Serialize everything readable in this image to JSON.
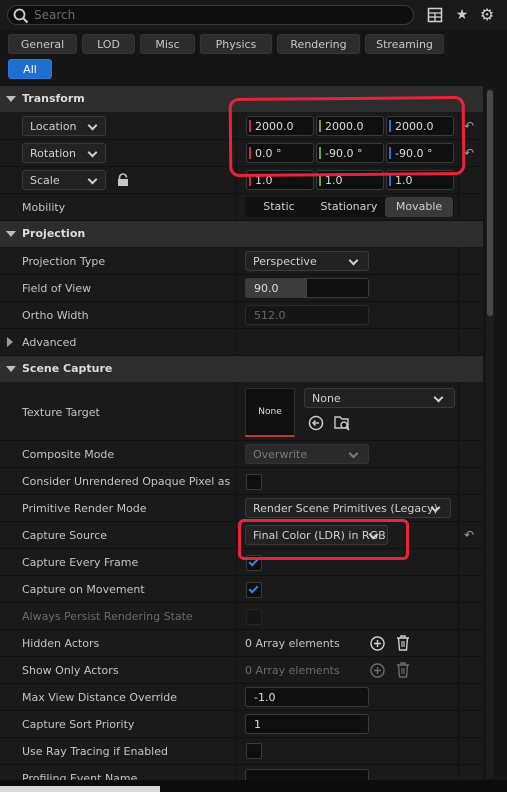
{
  "search": {
    "placeholder": "Search"
  },
  "toolbar": {
    "icons": [
      "table-icon",
      "star-icon",
      "gear-icon"
    ]
  },
  "filters": {
    "tabs": [
      "General",
      "LOD",
      "Misc",
      "Physics",
      "Rendering",
      "Streaming"
    ],
    "all": "All"
  },
  "transform": {
    "title": "Transform",
    "location": {
      "label": "Location",
      "x": "2000.0",
      "y": "2000.0",
      "z": "2000.0"
    },
    "rotation": {
      "label": "Rotation",
      "x": "0.0 °",
      "y": "-90.0 °",
      "z": "-90.0 °"
    },
    "scale": {
      "label": "Scale",
      "x": "1.0",
      "y": "1.0",
      "z": "1.0"
    },
    "mobility": {
      "label": "Mobility",
      "options": [
        "Static",
        "Stationary",
        "Movable"
      ],
      "selected": "Movable"
    }
  },
  "projection": {
    "title": "Projection",
    "projection_type": {
      "label": "Projection Type",
      "value": "Perspective"
    },
    "fov": {
      "label": "Field of View",
      "value": "90.0",
      "fill_fraction": 0.5
    },
    "ortho_width": {
      "label": "Ortho Width",
      "value": "512.0"
    },
    "advanced": "Advanced"
  },
  "scene_capture": {
    "title": "Scene Capture",
    "texture_target": {
      "label": "Texture Target",
      "thumb": "None",
      "value": "None"
    },
    "composite_mode": {
      "label": "Composite Mode",
      "value": "Overwrite"
    },
    "consider_unrendered": {
      "label": "Consider Unrendered Opaque Pixel as F...",
      "checked": false
    },
    "primitive_render_mode": {
      "label": "Primitive Render Mode",
      "value": "Render Scene Primitives (Legacy)"
    },
    "capture_source": {
      "label": "Capture Source",
      "value": "Final Color (LDR) in RGB"
    },
    "capture_every_frame": {
      "label": "Capture Every Frame",
      "checked": true
    },
    "capture_on_movement": {
      "label": "Capture on Movement",
      "checked": true
    },
    "always_persist": {
      "label": "Always Persist Rendering State",
      "checked": false
    },
    "hidden_actors": {
      "label": "Hidden Actors",
      "value": "0 Array elements"
    },
    "show_only_actors": {
      "label": "Show Only Actors",
      "value": "0 Array elements"
    },
    "max_view_distance": {
      "label": "Max View Distance Override",
      "value": "-1.0"
    },
    "capture_sort_priority": {
      "label": "Capture Sort Priority",
      "value": "1"
    },
    "use_ray_tracing": {
      "label": "Use Ray Tracing if Enabled",
      "checked": false
    },
    "profiling_event_name": {
      "label": "Profiling Event Name"
    }
  },
  "colors": {
    "accent": "#1f6fd1",
    "axis_x": "#c8322a",
    "axis_y": "#6aa832",
    "axis_z": "#2c6fd6",
    "annotation": "#e8243c",
    "check": "#2f8be6"
  }
}
